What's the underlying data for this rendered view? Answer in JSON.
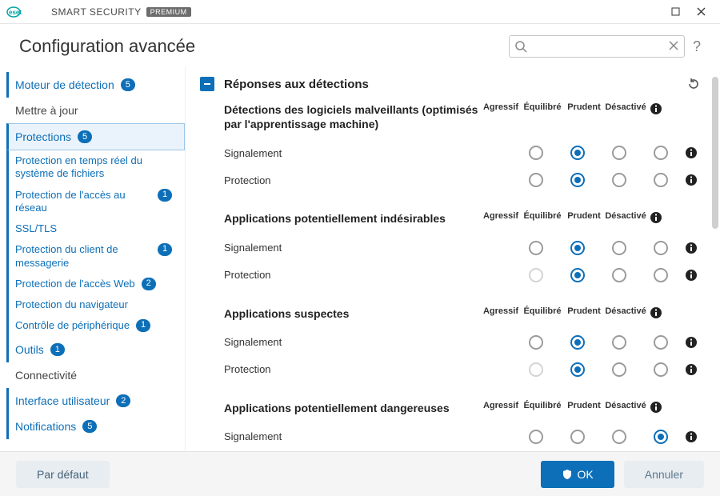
{
  "titlebar": {
    "product_prefix": "SMART SECURITY",
    "product_badge": "PREMIUM"
  },
  "header": {
    "title": "Configuration avancée",
    "search_placeholder": ""
  },
  "sidebar": {
    "items": [
      {
        "label": "Moteur de détection",
        "badge": "5",
        "kind": "top",
        "active": true
      },
      {
        "label": "Mettre à jour",
        "kind": "top"
      },
      {
        "label": "Protections",
        "badge": "5",
        "kind": "top",
        "selected": true
      },
      {
        "label": "Protection en temps réel du système de fichiers",
        "kind": "sub"
      },
      {
        "label": "Protection de l'accès au réseau",
        "badge": "1",
        "kind": "sub"
      },
      {
        "label": "SSL/TLS",
        "kind": "sub"
      },
      {
        "label": "Protection du client de messagerie",
        "badge": "1",
        "kind": "sub"
      },
      {
        "label": "Protection de l'accès Web",
        "badge": "2",
        "kind": "sub"
      },
      {
        "label": "Protection du navigateur",
        "kind": "sub"
      },
      {
        "label": "Contrôle de périphérique",
        "badge": "1",
        "kind": "sub"
      },
      {
        "label": "Outils",
        "badge": "1",
        "kind": "top",
        "active": true
      },
      {
        "label": "Connectivité",
        "kind": "top"
      },
      {
        "label": "Interface utilisateur",
        "badge": "2",
        "kind": "top",
        "active": true
      },
      {
        "label": "Notifications",
        "badge": "5",
        "kind": "top",
        "active": true
      }
    ]
  },
  "section": {
    "title": "Réponses aux détections",
    "columns": [
      "Agressif",
      "Équilibré",
      "Prudent",
      "Désactivé"
    ],
    "row_labels": {
      "signal": "Signalement",
      "protect": "Protection"
    },
    "groups": [
      {
        "title": "Détections des logiciels malveillants (optimisés par l'apprentissage machine)",
        "rows": [
          {
            "key": "signal",
            "values": [
              "off",
              "on",
              "off",
              "off"
            ]
          },
          {
            "key": "protect",
            "values": [
              "off",
              "on",
              "off",
              "off"
            ]
          }
        ]
      },
      {
        "title": "Applications potentiellement indésirables",
        "rows": [
          {
            "key": "signal",
            "values": [
              "off",
              "on",
              "off",
              "off"
            ]
          },
          {
            "key": "protect",
            "values": [
              "disabled",
              "on",
              "off",
              "off"
            ]
          }
        ]
      },
      {
        "title": "Applications suspectes",
        "rows": [
          {
            "key": "signal",
            "values": [
              "off",
              "on",
              "off",
              "off"
            ]
          },
          {
            "key": "protect",
            "values": [
              "disabled",
              "on",
              "off",
              "off"
            ]
          }
        ]
      },
      {
        "title": "Applications potentiellement dangereuses",
        "rows": [
          {
            "key": "signal",
            "values": [
              "off",
              "off",
              "off",
              "on"
            ]
          }
        ]
      }
    ]
  },
  "footer": {
    "default_label": "Par défaut",
    "ok_label": "OK",
    "cancel_label": "Annuler"
  }
}
